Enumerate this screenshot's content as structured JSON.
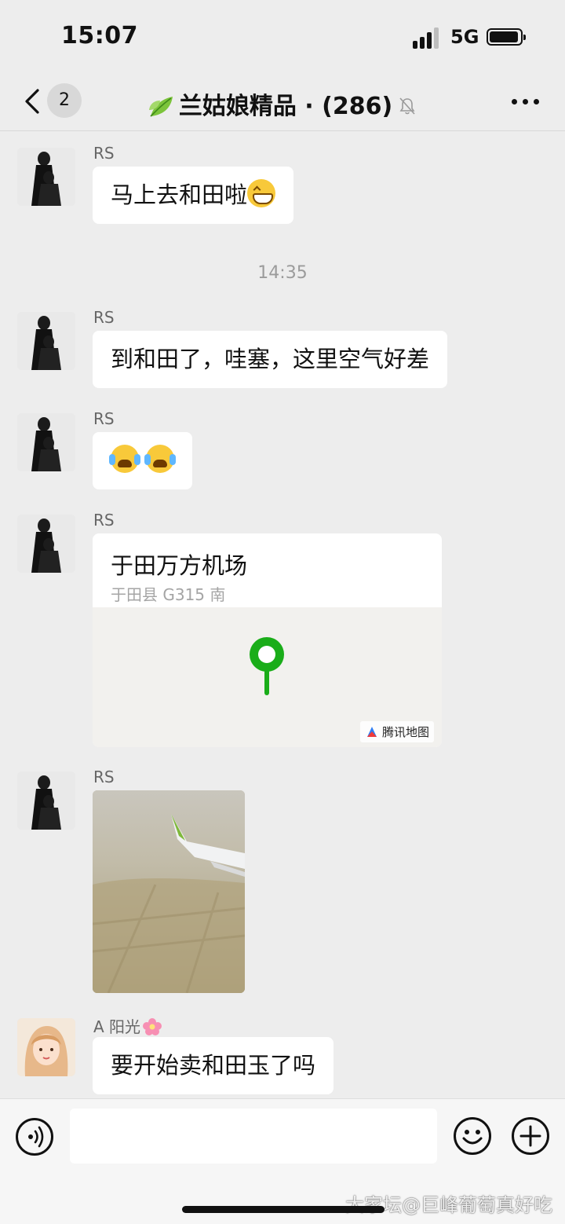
{
  "status_bar": {
    "time": "15:07",
    "network": "5G"
  },
  "nav": {
    "unread_count": "2",
    "title": "兰姑娘精品 · (286)"
  },
  "messages": [
    {
      "sender": "RS",
      "text": "马上去和田啦"
    },
    {
      "timestamp": "14:35"
    },
    {
      "sender": "RS",
      "text": "到和田了，哇塞，这里空气好差"
    },
    {
      "sender": "RS",
      "emoji": [
        "crying-face",
        "crying-face"
      ]
    },
    {
      "sender": "RS",
      "location_name": "于田万方机场",
      "location_address": "于田县 G315 南",
      "map_brand": "腾讯地图"
    },
    {
      "sender": "RS",
      "image": "airplane-wing-photo"
    },
    {
      "sender": "A 阳光",
      "text": "要开始卖和田玉了吗"
    }
  ],
  "input": {
    "placeholder": ""
  },
  "watermark": "大家坛@巨峰葡萄真好吃"
}
